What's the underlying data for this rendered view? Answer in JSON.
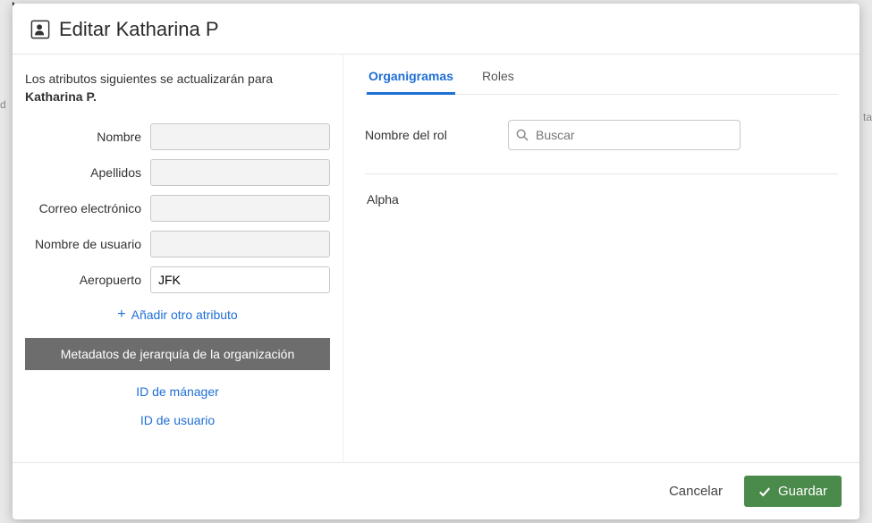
{
  "header": {
    "title": "Editar Katharina P"
  },
  "intro": {
    "prefix": "Los atributos siguientes se actualizarán para ",
    "subject": "Katharina P."
  },
  "fields": {
    "name_label": "Nombre",
    "name_value": "",
    "surname_label": "Apellidos",
    "surname_value": "",
    "email_label": "Correo electrónico",
    "email_value": "",
    "username_label": "Nombre de usuario",
    "username_value": "",
    "airport_label": "Aeropuerto",
    "airport_value": "JFK"
  },
  "add_attribute_label": "Añadir otro atributo",
  "metadata_header": "Metadatos de jerarquía de la organización",
  "meta_links": {
    "manager": "ID de mánager",
    "user": "ID de usuario"
  },
  "tabs": {
    "orgcharts": "Organigramas",
    "roles": "Roles"
  },
  "role_search_label": "Nombre del rol",
  "search_placeholder": "Buscar",
  "role_items": [
    "Alpha"
  ],
  "footer": {
    "cancel": "Cancelar",
    "save": "Guardar"
  },
  "bg_left": "d",
  "bg_right": "ta"
}
